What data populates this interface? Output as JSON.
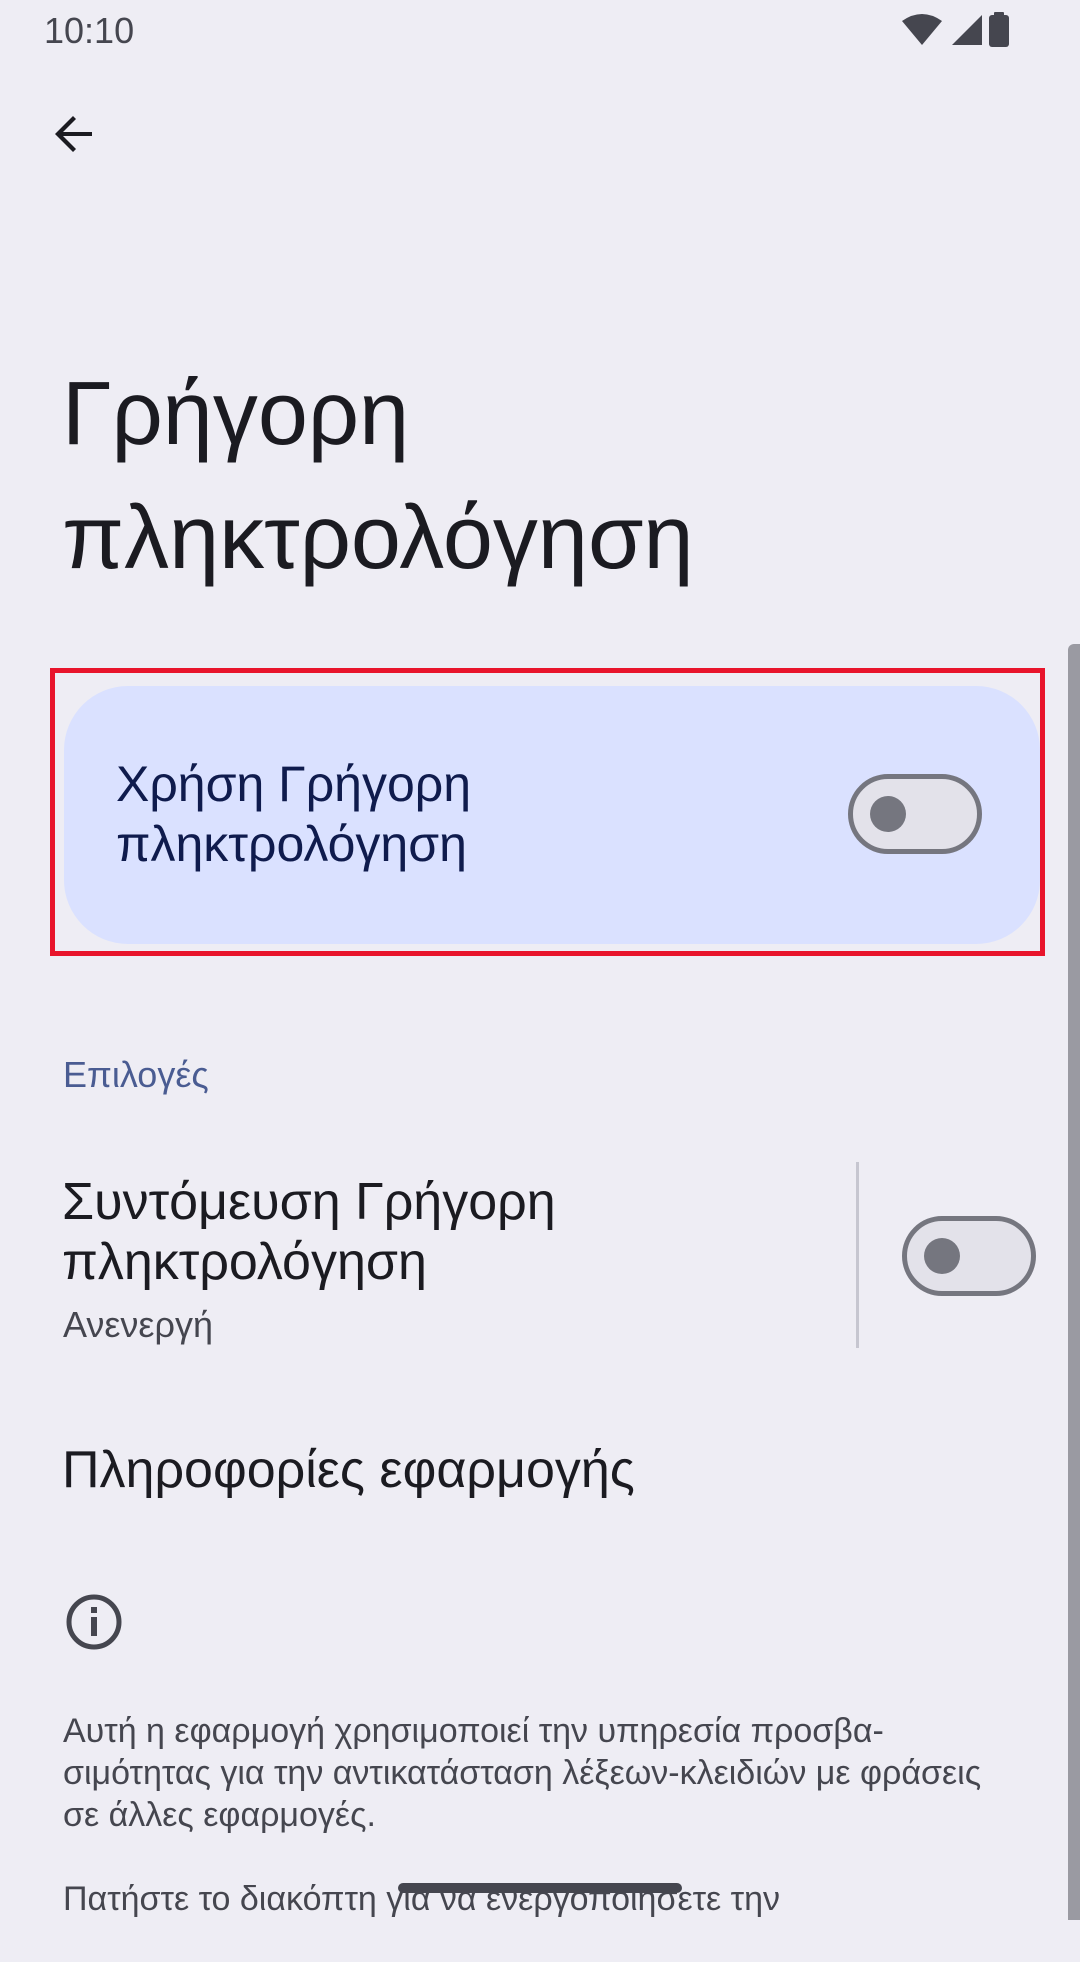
{
  "status_bar": {
    "time": "10:10",
    "icons": [
      "wifi-icon",
      "signal-icon",
      "battery-icon"
    ]
  },
  "toolbar": {
    "back_icon": "arrow-back-icon"
  },
  "page": {
    "title": "Γρήγορη πληκτρολόγηση"
  },
  "main_switch": {
    "label": "Χρήση Γρήγορη πληκτρολόγηση",
    "checked": false
  },
  "options": {
    "header": "Επιλογές",
    "shortcut": {
      "title": "Συντόμευση Γρήγορη πληκτρολόγηση",
      "summary": "Ανενεργή",
      "checked": false
    },
    "app_info": {
      "label": "Πληροφορίες εφαρμογής"
    }
  },
  "footer": {
    "icon": "info-icon",
    "paragraph1": "Αυτή η εφαρμογή χρησιμοποιεί την υπηρεσία προσβα-σιμότητας για την αντικατάσταση λέξεων-κλειδιών με φράσεις σε άλλες εφαρμογές.",
    "paragraph2": "Πατήστε το διακόπτη για να ενεργοποιήσετε την"
  },
  "colors": {
    "background": "#EEEDF4",
    "card": "#DAE1FF",
    "accent_text": "#4A5C92",
    "highlight_frame": "#E8142B"
  }
}
